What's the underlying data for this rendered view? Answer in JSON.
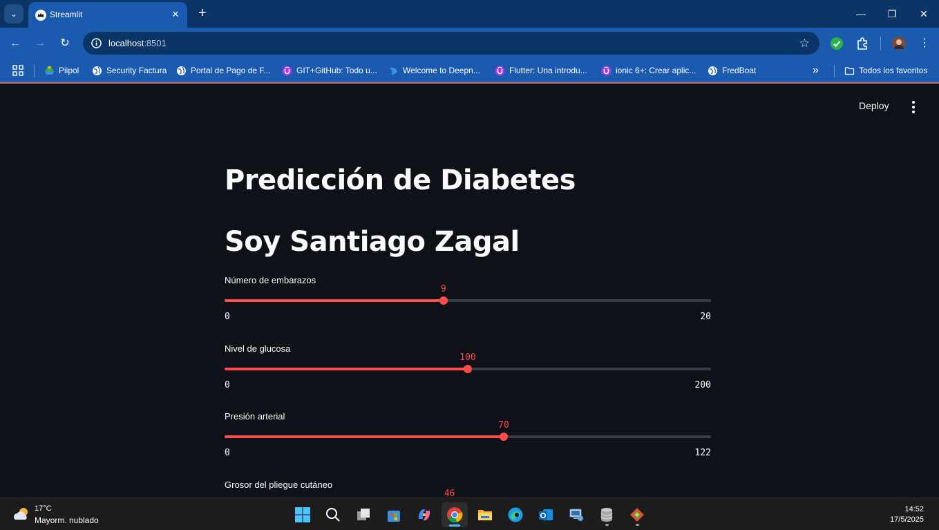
{
  "browser": {
    "tab_title": "Streamlit",
    "url_host": "localhost",
    "url_port": ":8501",
    "bookmarks": [
      {
        "label": "Piipol",
        "icon": "drive-icon"
      },
      {
        "label": "Security Factura",
        "icon": "globe-icon"
      },
      {
        "label": "Portal de Pago de F...",
        "icon": "globe-icon"
      },
      {
        "label": "GIT+GitHub: Todo u...",
        "icon": "udemy-icon"
      },
      {
        "label": "Welcome to Deepn...",
        "icon": "deepnote-icon"
      },
      {
        "label": "Flutter: Una introdu...",
        "icon": "udemy-icon"
      },
      {
        "label": "ionic 6+: Crear aplic...",
        "icon": "udemy-icon"
      },
      {
        "label": "FredBoat",
        "icon": "globe-icon"
      }
    ],
    "overflow_label": "»",
    "all_bookmarks_label": "Todos los favoritos"
  },
  "app": {
    "deploy_label": "Deploy",
    "title": "Predicción de Diabetes",
    "subtitle": "Soy Santiago Zagal",
    "sliders": [
      {
        "label": "Número de embarazos",
        "value": "9",
        "min": "0",
        "max": "20",
        "fraction": 0.45
      },
      {
        "label": "Nivel de glucosa",
        "value": "100",
        "min": "0",
        "max": "200",
        "fraction": 0.5
      },
      {
        "label": "Presión arterial",
        "value": "70",
        "min": "0",
        "max": "122",
        "fraction": 0.5738
      },
      {
        "label": "Grosor del pliegue cutáneo",
        "value": "46",
        "min": "",
        "max": "",
        "fraction": 0.4626
      }
    ],
    "accent_color": "#ff4b4b"
  },
  "taskbar": {
    "weather_temp": "17°C",
    "weather_desc": "Mayorm. nublado",
    "time": "14:52",
    "date": "17/5/2025"
  }
}
